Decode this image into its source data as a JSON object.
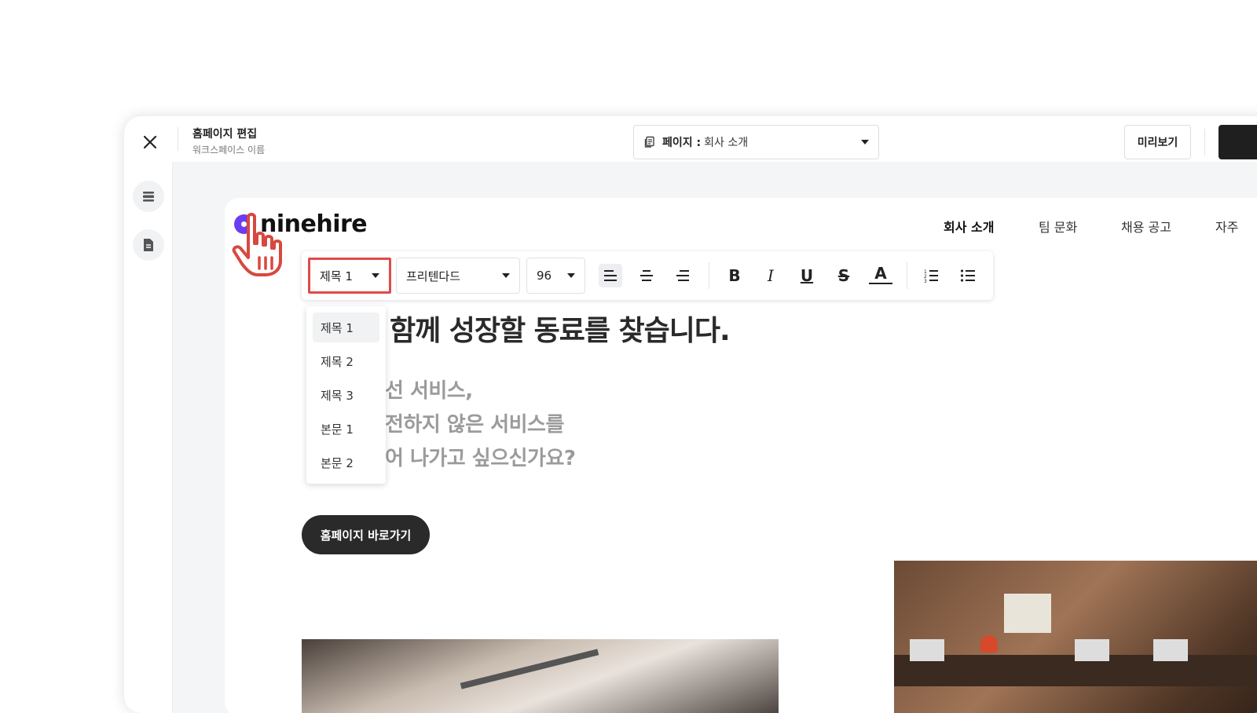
{
  "app": {
    "title": "홈페이지 편집",
    "subtitle": "워크스페이스 이름",
    "page_selector": {
      "label": "페이지 :",
      "value": "회사 소개"
    },
    "preview_label": "미리보기"
  },
  "site": {
    "logo_text": "ninehire",
    "nav": [
      "회사 소개",
      "팀 문화",
      "채용 공고",
      "자주"
    ]
  },
  "toolbar": {
    "style_value": "제목 1",
    "font_value": "프리텐다드",
    "size_value": "96",
    "icons": {
      "align_left": "B",
      "bold": "B",
      "italic": "I",
      "underline": "U",
      "strike": "S",
      "text_color": "A"
    }
  },
  "dropdown": {
    "items": [
      "제목 1",
      "제목 2",
      "제목 3",
      "본문 1",
      "본문 2"
    ],
    "selected": "제목 1"
  },
  "hero": {
    "heading": "함께 성장할 동료를 찾습니다.",
    "subtext_lines": [
      "선 서비스,",
      "전하지 않은 서비스를",
      "어 나가고 싶으신가요?"
    ],
    "cta_label": "홈페이지 바로가기"
  },
  "colors": {
    "brand": "#6a3df0",
    "highlight": "#e04a4a",
    "cta_bg": "#2a2a2a"
  }
}
